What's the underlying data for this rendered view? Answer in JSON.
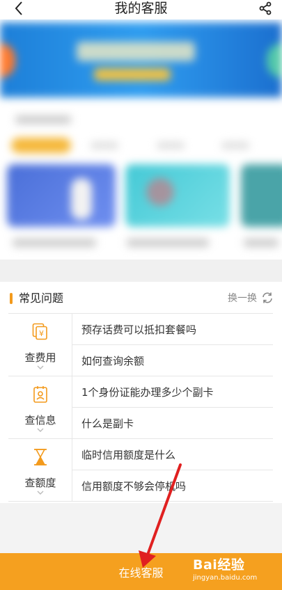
{
  "header": {
    "title": "我的客服",
    "back_icon": "chevron-left-icon",
    "share_icon": "share-icon"
  },
  "faq": {
    "title": "常见问题",
    "refresh_label": "换一换",
    "groups": [
      {
        "category": "查费用",
        "icon": "yuan-bill-icon",
        "questions": [
          "预存话费可以抵扣套餐吗",
          "如何查询余额"
        ]
      },
      {
        "category": "查信息",
        "icon": "id-card-icon",
        "questions": [
          "1个身份证能办理多少个副卡",
          "什么是副卡"
        ]
      },
      {
        "category": "查额度",
        "icon": "hourglass-icon",
        "questions": [
          "临时信用额度是什么",
          "信用额度不够会停机吗"
        ]
      }
    ]
  },
  "cta": {
    "label": "在线客服"
  },
  "watermark": {
    "brand": "Bai经验",
    "url": "jingyan.baidu.com"
  },
  "colors": {
    "accent": "#f39a1c",
    "cta": "#f5a01f",
    "arrow": "#e02020"
  }
}
